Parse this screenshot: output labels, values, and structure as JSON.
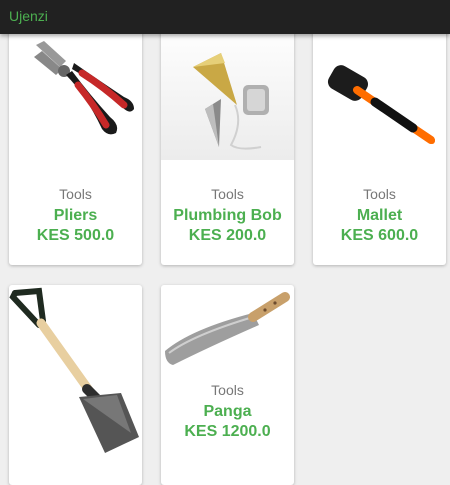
{
  "app": {
    "title": "Ujenzi"
  },
  "products": [
    {
      "category": "Tools",
      "name": "Pliers",
      "price": "KES 500.0",
      "icon": "pliers-icon"
    },
    {
      "category": "Tools",
      "name": "Plumbing Bob",
      "price": "KES 200.0",
      "icon": "plumb-bob-icon"
    },
    {
      "category": "Tools",
      "name": "Mallet",
      "price": "KES 600.0",
      "icon": "mallet-icon"
    },
    {
      "category": "",
      "name": "",
      "price": "",
      "icon": "shovel-icon"
    },
    {
      "category": "Tools",
      "name": "Panga",
      "price": "KES 1200.0",
      "icon": "panga-icon"
    }
  ],
  "colors": {
    "accent": "#4caf50",
    "appbar": "#212121",
    "background": "#efefef"
  }
}
